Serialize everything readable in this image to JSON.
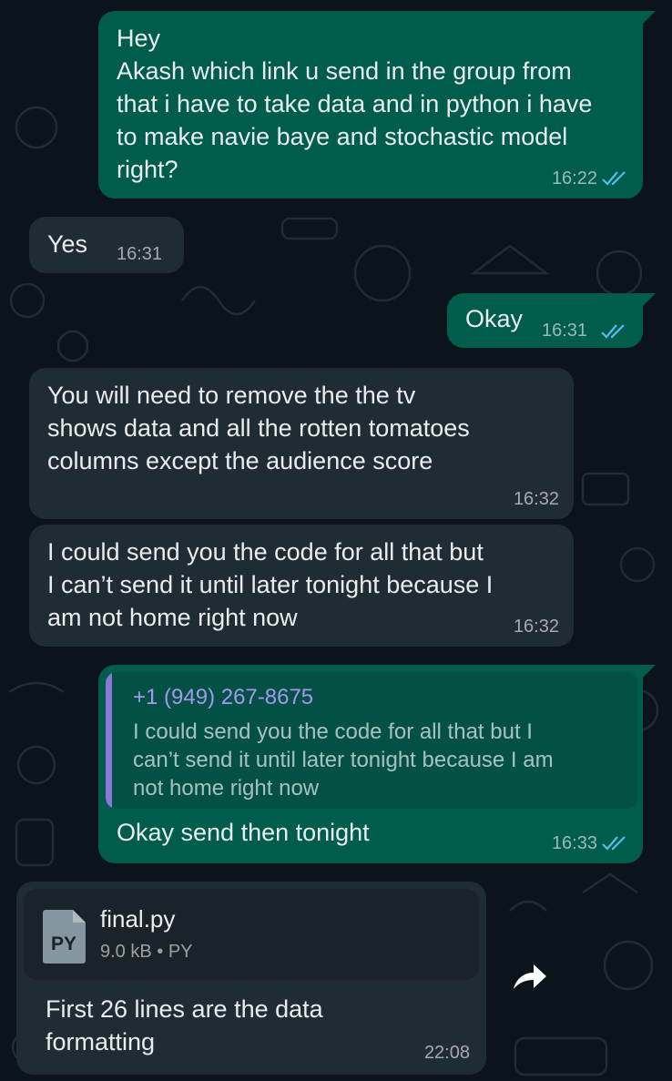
{
  "theme": {
    "background": "#0b141a",
    "outgoing_bubble": "#005c4b",
    "incoming_bubble": "#202c33",
    "read_ticks": "#53bdeb",
    "quote_accent": "#8a77d6"
  },
  "messages": {
    "m1": {
      "direction": "outgoing",
      "text": "Hey\nAkash which link u send in the group from that i have to take data and in python i have to  make navie baye and stochastic model right?",
      "time": "16:22",
      "status": "read"
    },
    "m2": {
      "direction": "incoming",
      "text": "Yes",
      "time": "16:31"
    },
    "m3": {
      "direction": "outgoing",
      "text": "Okay",
      "time": "16:31",
      "status": "read"
    },
    "m4": {
      "direction": "incoming",
      "text": "You will need to remove the the tv\nshows data and all the rotten tomatoes\ncolumns except the audience score",
      "time": "16:32"
    },
    "m5": {
      "direction": "incoming",
      "text": "I could send you the code for all that but\nI can’t send it until later tonight because I\nam not home right now",
      "time": "16:32"
    },
    "m6": {
      "direction": "outgoing",
      "quote": {
        "author": "+1 (949) 267-8675",
        "text": "I could send you the code for all that but I\ncan’t send it until later tonight because I am\nnot home right now"
      },
      "text": "Okay send then tonight",
      "time": "16:33",
      "status": "read"
    },
    "m7": {
      "direction": "incoming",
      "file": {
        "name": "final.py",
        "size": "9.0 kB",
        "separator": "•",
        "type": "PY",
        "icon_label": "PY",
        "icon": "document-icon"
      },
      "text": "First 26 lines are the data\nformatting",
      "time": "22:08"
    }
  },
  "actions": {
    "forward_icon": "forward-arrow-icon"
  }
}
